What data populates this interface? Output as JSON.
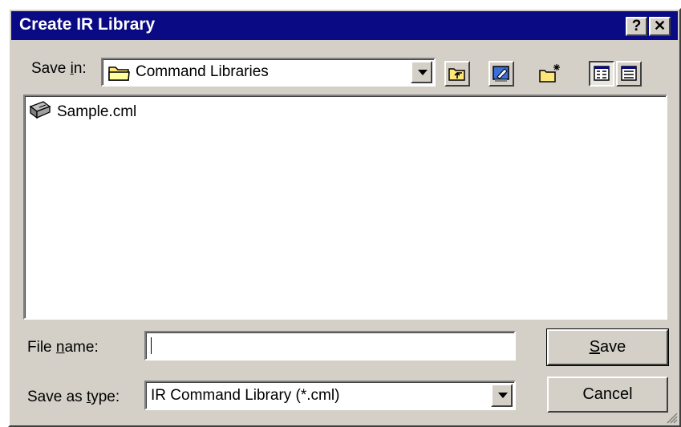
{
  "window": {
    "title": "Create IR Library",
    "help_label": "?",
    "close_label": "✕"
  },
  "save_in": {
    "label_pre": "Save ",
    "label_key": "i",
    "label_post": "n:",
    "value": "Command Libraries"
  },
  "toolbar": {
    "icons": [
      "up-one-level-icon",
      "view-desktop-icon",
      "create-new-folder-icon",
      "list-view-icon",
      "details-view-icon"
    ]
  },
  "files": [
    {
      "name": "Sample.cml",
      "icon": "cml-file-icon"
    }
  ],
  "file_name": {
    "label_pre": "File ",
    "label_key": "n",
    "label_post": "ame:",
    "value": ""
  },
  "save_as_type": {
    "label_pre": "Save as ",
    "label_key": "t",
    "label_post": "ype:",
    "value": "IR Command Library (*.cml)"
  },
  "buttons": {
    "save_key": "S",
    "save_rest": "ave",
    "cancel": "Cancel"
  }
}
